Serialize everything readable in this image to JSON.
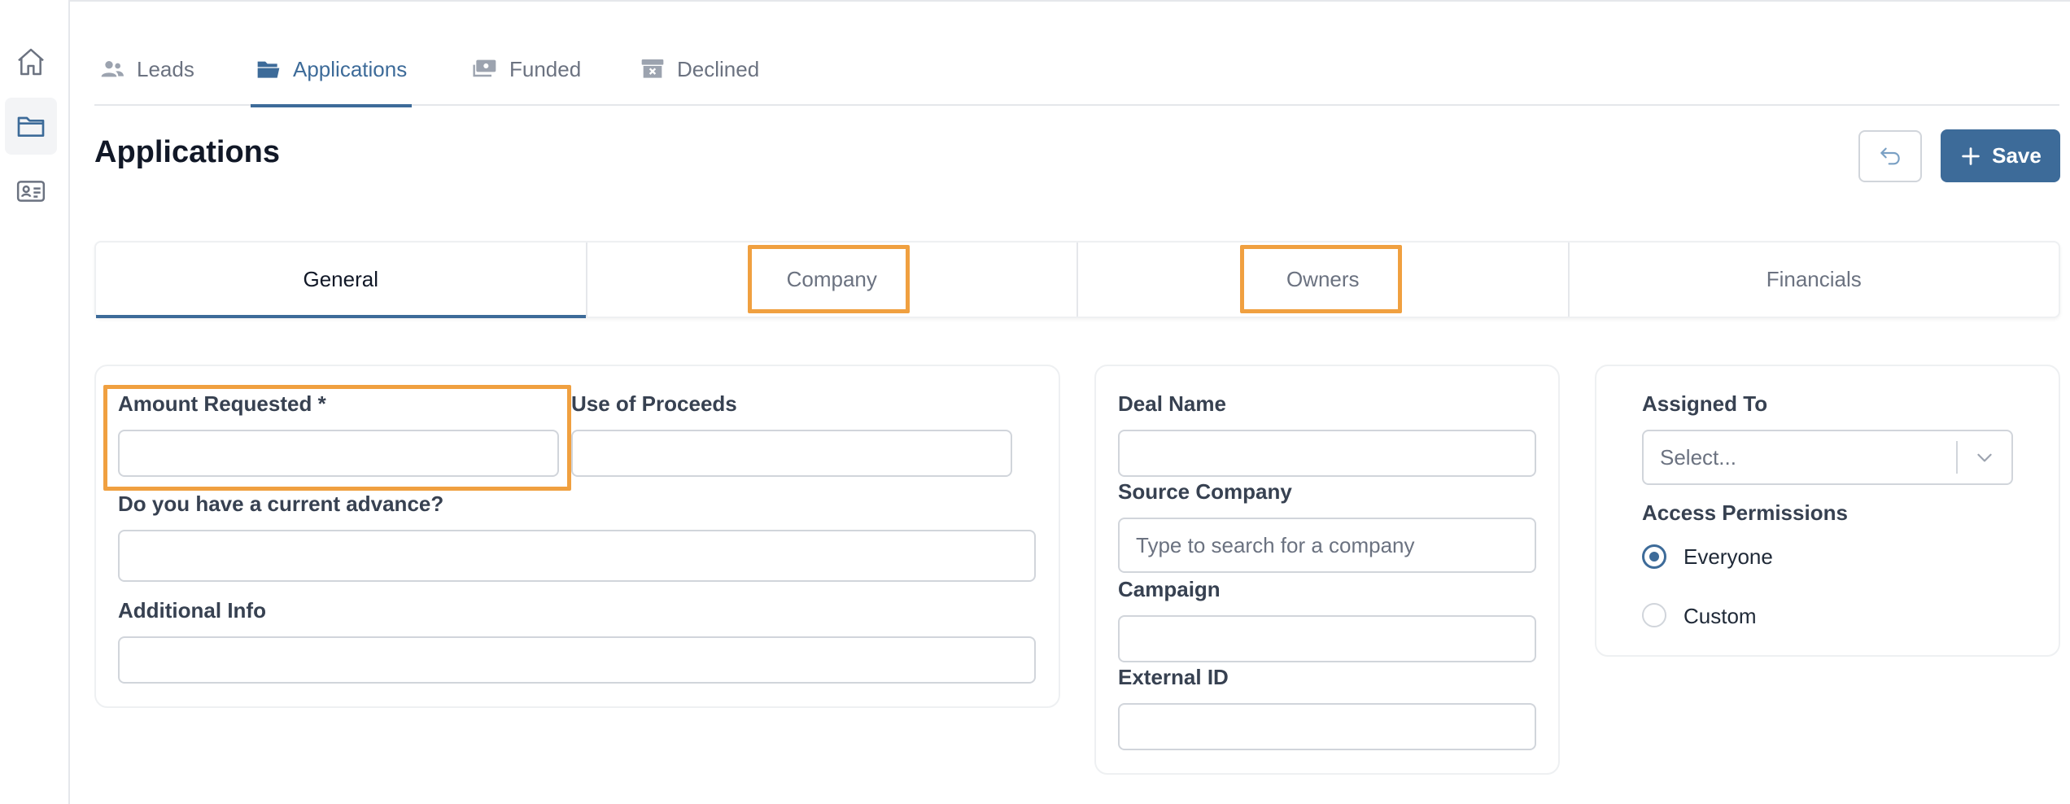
{
  "sidebar": {
    "items": [
      {
        "name": "home",
        "icon": "home-icon",
        "active": false
      },
      {
        "name": "applications",
        "icon": "folder-icon",
        "active": true
      },
      {
        "name": "contacts",
        "icon": "id-card-icon",
        "active": false
      }
    ]
  },
  "nav_tabs": [
    {
      "label": "Leads",
      "icon": "users-icon"
    },
    {
      "label": "Applications",
      "icon": "folder-open-icon",
      "active": true
    },
    {
      "label": "Funded",
      "icon": "money-icon"
    },
    {
      "label": "Declined",
      "icon": "archive-x-icon"
    }
  ],
  "page": {
    "title": "Applications",
    "undo_icon": "undo-icon",
    "save_label": "Save"
  },
  "sub_tabs": [
    {
      "label": "General",
      "active": true
    },
    {
      "label": "Company"
    },
    {
      "label": "Owners"
    },
    {
      "label": "Financials"
    }
  ],
  "general_card": {
    "amount_requested": {
      "label": "Amount Requested *",
      "value": ""
    },
    "use_of_proceeds": {
      "label": "Use of Proceeds",
      "value": ""
    },
    "current_advance": {
      "label": "Do you have a current advance?",
      "value": ""
    },
    "additional_info": {
      "label": "Additional Info",
      "value": ""
    }
  },
  "deal_card": {
    "deal_name": {
      "label": "Deal Name",
      "value": ""
    },
    "source_company": {
      "label": "Source Company",
      "value": "",
      "placeholder": "Type to search for a company"
    },
    "campaign": {
      "label": "Campaign",
      "value": ""
    },
    "external_id": {
      "label": "External ID",
      "value": ""
    }
  },
  "assign_card": {
    "assigned_to": {
      "label": "Assigned To",
      "placeholder": "Select..."
    },
    "access_permissions": {
      "label": "Access Permissions",
      "options": [
        {
          "label": "Everyone",
          "checked": true
        },
        {
          "label": "Custom",
          "checked": false
        }
      ]
    }
  },
  "colors": {
    "accent": "#3d6b99",
    "highlight": "#f0a040",
    "border": "#d1d5db"
  }
}
